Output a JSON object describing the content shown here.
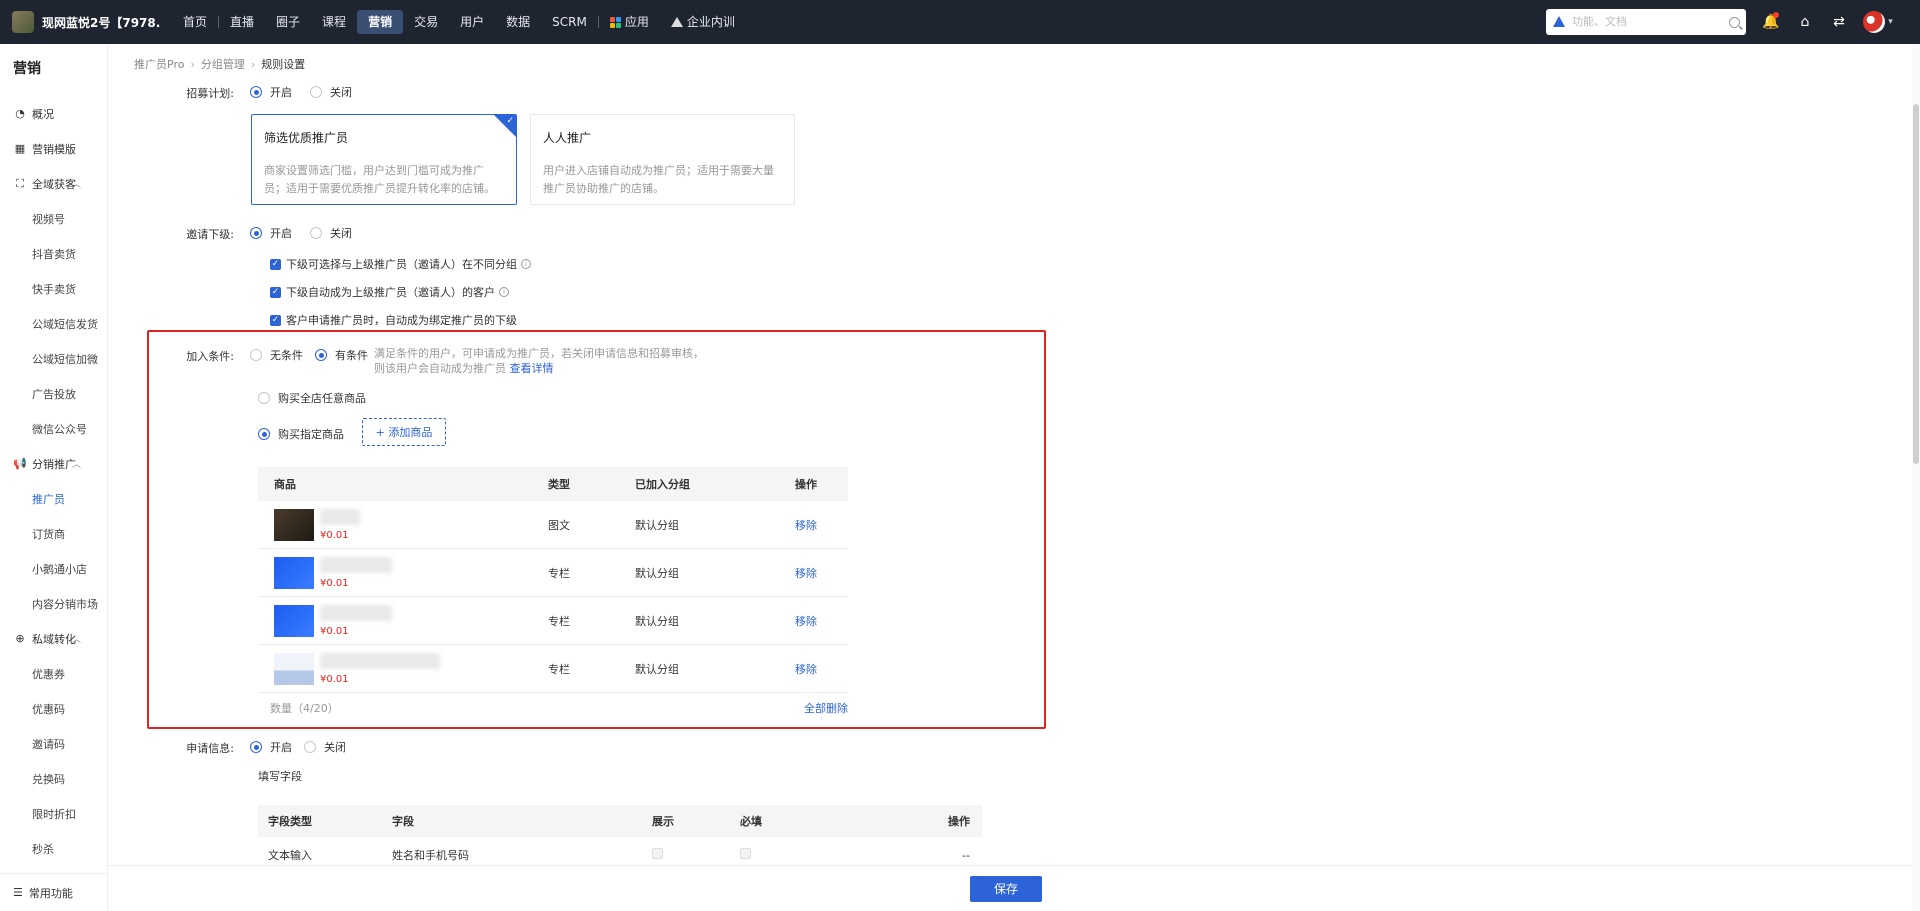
{
  "topbar": {
    "brand": "现网蓝悦2号【7978...",
    "nav": [
      "首页",
      "直播",
      "圈子",
      "课程",
      "营销",
      "交易",
      "用户",
      "数据",
      "SCRM",
      "应用",
      "企业内训"
    ],
    "search_placeholder": "功能、文档"
  },
  "sidebar": {
    "title": "营销",
    "overview": "概况",
    "templates": "营销模版",
    "group1": "全域获客",
    "group1_items": [
      "视频号",
      "抖音卖货",
      "快手卖货",
      "公域短信发货",
      "公域短信加微",
      "广告投放",
      "微信公众号"
    ],
    "group2": "分销推广",
    "group2_items": [
      "推广员",
      "订货商",
      "小鹅通小店",
      "内容分销市场"
    ],
    "group3": "私域转化",
    "group3_items": [
      "优惠券",
      "优惠码",
      "邀请码",
      "兑换码",
      "限时折扣",
      "秒杀"
    ],
    "bottom": "常用功能"
  },
  "breadcrumb": [
    "推广员Pro",
    "分组管理",
    "规则设置"
  ],
  "recruit": {
    "label": "招募计划:",
    "on": "开启",
    "off": "关闭",
    "card1_title": "筛选优质推广员",
    "card1_desc": "商家设置筛选门槛，用户达到门槛可成为推广员；适用于需要优质推广员提升转化率的店铺。",
    "card2_title": "人人推广",
    "card2_desc": "用户进入店铺自动成为推广员；适用于需要大量推广员协助推广的店铺。"
  },
  "invite": {
    "label": "邀请下级:",
    "on": "开启",
    "off": "关闭",
    "opt1": "下级可选择与上级推广员（邀请人）在不同分组",
    "opt2": "下级自动成为上级推广员（邀请人）的客户",
    "opt3": "客户申请推广员时，自动成为绑定推广员的下级"
  },
  "join": {
    "label": "加入条件:",
    "none": "无条件",
    "has": "有条件",
    "desc1": "满足条件的用户，可申请成为推广员，若关闭申请信息和招募审核，",
    "desc2": "则该用户会自动成为推广员",
    "detail_link": "查看详情",
    "any_goods": "购买全店任意商品",
    "specific_goods": "购买指定商品",
    "add_goods": "+ 添加商品",
    "table_headers": [
      "商品",
      "类型",
      "已加入分组",
      "操作"
    ],
    "rows": [
      {
        "price": "¥0.01",
        "type": "图文",
        "group": "默认分组",
        "action": "移除",
        "thumb": "dark"
      },
      {
        "price": "¥0.01",
        "type": "专栏",
        "group": "默认分组",
        "action": "移除",
        "thumb": "blue"
      },
      {
        "price": "¥0.01",
        "type": "专栏",
        "group": "默认分组",
        "action": "移除",
        "thumb": "blue"
      },
      {
        "price": "¥0.01",
        "type": "专栏",
        "group": "默认分组",
        "action": "移除",
        "thumb": "light"
      }
    ],
    "count": "数量（4/20）",
    "delete_all": "全部删除"
  },
  "apply": {
    "label": "申请信息:",
    "on": "开启",
    "off": "关闭",
    "fields_title": "填写字段",
    "headers": [
      "字段类型",
      "字段",
      "展示",
      "必填",
      "操作"
    ],
    "row": {
      "type": "文本输入",
      "field": "姓名和手机号码",
      "action": "--"
    }
  },
  "footer": {
    "save": "保存"
  },
  "colors": {
    "primary": "#2d63d8",
    "highlight": "#e02424",
    "topbar": "#1f2431"
  }
}
